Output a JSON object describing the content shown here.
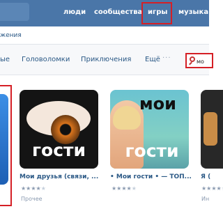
{
  "header": {
    "nav": [
      "люди",
      "сообщества",
      "игры",
      "музыка"
    ],
    "highlighted": "игры",
    "accent_color": "#4a76a8",
    "highlight_color": "#d51f25"
  },
  "breadcrumb": "жения",
  "categories": {
    "items": [
      "ые",
      "Головоломки",
      "Приключения",
      "Ещё"
    ],
    "more_icon": "more-dots-icon",
    "search_icon": "magnifier-icon",
    "search_value": "мо"
  },
  "apps": [
    {
      "title": "Мои друзья (связи, ...",
      "image_caption": "гости",
      "rating": 4,
      "rating_max": 5,
      "category": "Прочее"
    },
    {
      "title": "• Мои гости • — ТОП...",
      "image_caption_top": "мои",
      "image_caption_bottom": "гости",
      "rating": 4,
      "rating_max": 5
    },
    {
      "title": "Я (",
      "rating": 4,
      "rating_max": 5,
      "category": "Ин"
    }
  ]
}
